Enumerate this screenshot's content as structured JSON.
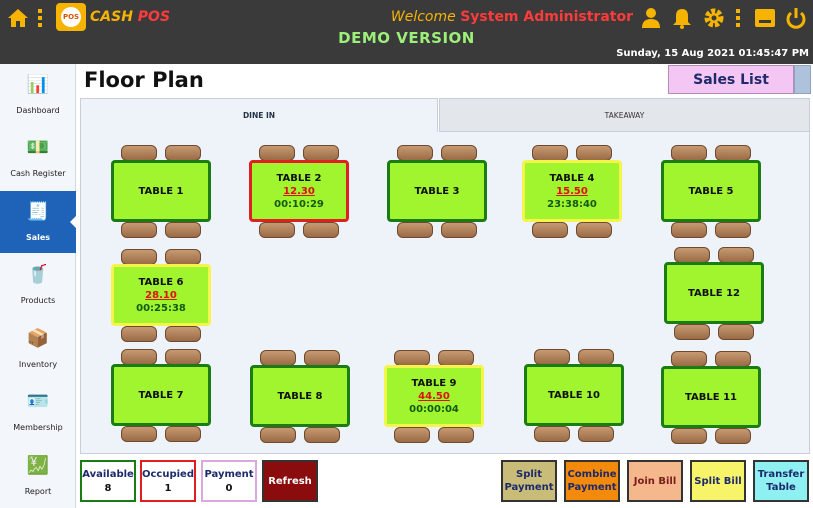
{
  "app": {
    "brand_part1": "CASH",
    "brand_part2": "POS",
    "logo_text": "POS",
    "welcome_prefix": "Welcome",
    "user_name": "System Administrator",
    "demo_label": "DEMO VERSION",
    "datetime": "Sunday, 15 Aug 2021 01:45:47 PM"
  },
  "sidebar": {
    "items": [
      {
        "label": "Dashboard",
        "icon": "dashboard-icon",
        "glyph": "📊"
      },
      {
        "label": "Cash Register",
        "icon": "cash-register-icon",
        "glyph": "💵"
      },
      {
        "label": "Sales",
        "icon": "sales-icon",
        "glyph": "🧾"
      },
      {
        "label": "Products",
        "icon": "products-icon",
        "glyph": "🥤"
      },
      {
        "label": "Inventory",
        "icon": "inventory-icon",
        "glyph": "📦"
      },
      {
        "label": "Membership",
        "icon": "membership-icon",
        "glyph": "🪪"
      },
      {
        "label": "Report",
        "icon": "report-icon",
        "glyph": "💹"
      }
    ],
    "active": "Sales"
  },
  "header": {
    "title": "Floor Plan",
    "sales_list_label": "Sales List"
  },
  "tabs": [
    {
      "label": "DINE IN",
      "selected": true
    },
    {
      "label": "TAKEAWAY",
      "selected": false
    }
  ],
  "tables": [
    {
      "name": "TABLE 1",
      "status": "available",
      "amount": "",
      "time": ""
    },
    {
      "name": "TABLE 2",
      "status": "occupied",
      "amount": "12.30",
      "time": "00:10:29"
    },
    {
      "name": "TABLE 3",
      "status": "available",
      "amount": "",
      "time": ""
    },
    {
      "name": "TABLE 4",
      "status": "payment",
      "amount": "15.50",
      "time": "23:38:40"
    },
    {
      "name": "TABLE 5",
      "status": "available",
      "amount": "",
      "time": ""
    },
    {
      "name": "TABLE 6",
      "status": "payment",
      "amount": "28.10",
      "time": "00:25:38"
    },
    {
      "name": "TABLE 12",
      "status": "available",
      "amount": "",
      "time": ""
    },
    {
      "name": "TABLE 7",
      "status": "available",
      "amount": "",
      "time": ""
    },
    {
      "name": "TABLE 8",
      "status": "available",
      "amount": "",
      "time": ""
    },
    {
      "name": "TABLE 9",
      "status": "payment",
      "amount": "44.50",
      "time": "00:00:04"
    },
    {
      "name": "TABLE 10",
      "status": "available",
      "amount": "",
      "time": ""
    },
    {
      "name": "TABLE 11",
      "status": "available",
      "amount": "",
      "time": ""
    }
  ],
  "stats": {
    "available_label": "Available",
    "available_count": "8",
    "occupied_label": "Occupied",
    "occupied_count": "1",
    "payment_label": "Payment",
    "payment_count": "0"
  },
  "buttons": {
    "refresh": "Refresh",
    "split_payment": "Split Payment",
    "combine_payment": "Combine Payment",
    "join_bill": "Join Bill",
    "split_bill": "Split Bill",
    "transfer_table": "Transfer Table"
  },
  "colors": {
    "topbar": "#3a3a3a",
    "brand_yellow": "#f6b400",
    "alert_red": "#ff3b3b",
    "demo_green": "#9cf07a",
    "table_fill": "#a0f52e",
    "available_border": "#1c7c14",
    "occupied_border": "#e02020",
    "payment_border": "#f4f44a",
    "active_nav": "#1e63b8"
  }
}
